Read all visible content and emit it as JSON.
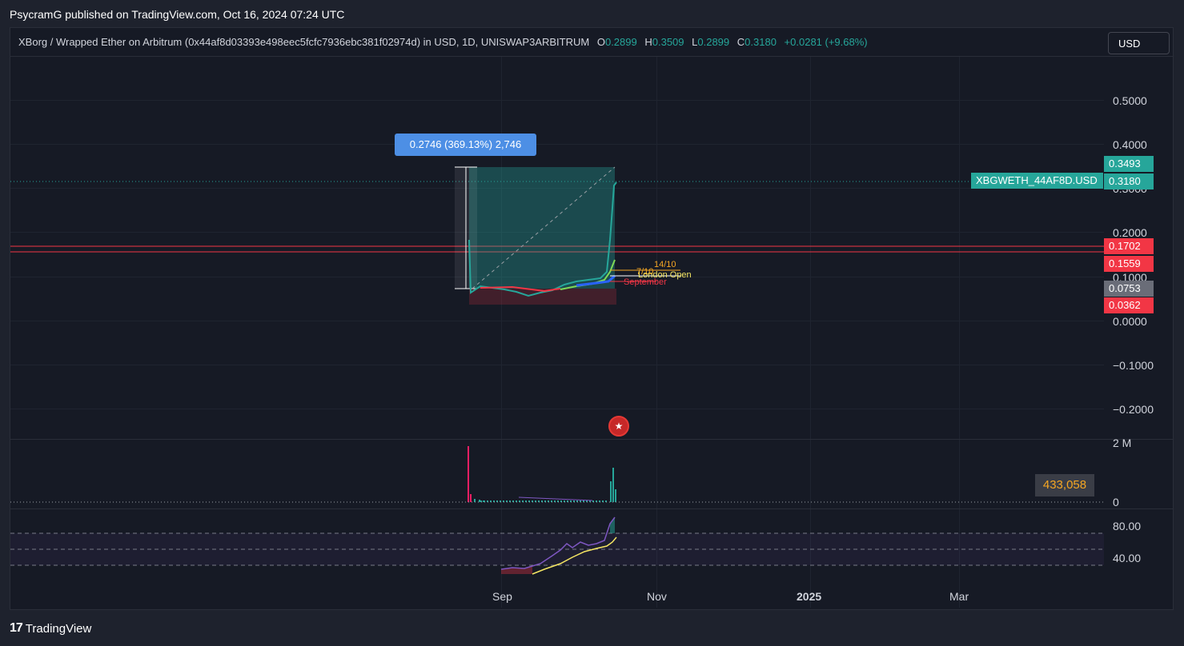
{
  "publisher_line": "PsycramG published on TradingView.com, Oct 16, 2024 07:24 UTC",
  "header": {
    "symbol": "XBorg / Wrapped Ether on Arbitrum (0x44af8d03393e498eec5fcfc7936ebc381f02974d) in USD, 1D, UNISWAP3ARBITRUM",
    "o_label": "O",
    "o_value": "0.2899",
    "h_label": "H",
    "h_value": "0.3509",
    "l_label": "L",
    "l_value": "0.2899",
    "c_label": "C",
    "c_value": "0.3180",
    "change": "+0.0281 (+9.68%)"
  },
  "currency_button": "USD",
  "price_axis": [
    "0.5000",
    "0.4000",
    "0.3000",
    "0.2000",
    "0.1000",
    "0.0000",
    "−0.1000",
    "−0.2000"
  ],
  "price_tags": {
    "high": "0.3493",
    "symbol_name": "XBGWETH_44AF8D.USD",
    "last": "0.3180",
    "line1": "0.1702",
    "line2": "0.1559",
    "gray": "0.0753",
    "low": "0.0362"
  },
  "colors": {
    "green": "#26a69a",
    "red": "#f23645",
    "blue_label": "#4d8fe5",
    "gray_tag": "#6a6d78"
  },
  "measure_label": "0.2746 (369.13%) 2,746",
  "annotations": {
    "date_1410": "14/10",
    "date_710": "7/10",
    "london_open": "London Open",
    "september": "September"
  },
  "volume_axis": {
    "top": "2 M",
    "bottom": "0"
  },
  "volume_value": "433,058",
  "rsi_axis": {
    "upper": "80.00",
    "lower": "40.00"
  },
  "time_axis": [
    "Sep",
    "Nov",
    "2025",
    "Mar"
  ],
  "brand": "TradingView",
  "flag_icon": "us-flag-icon"
}
